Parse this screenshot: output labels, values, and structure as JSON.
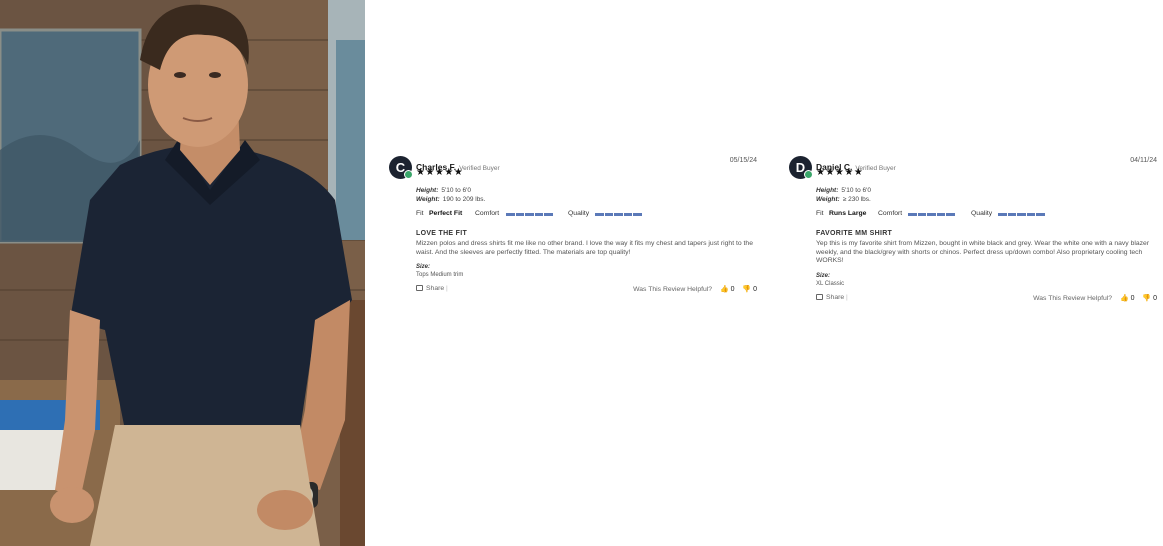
{
  "hero_image": {
    "alt": "Model wearing navy polo shirt and khaki pants"
  },
  "reviews": [
    {
      "avatar_letter": "C",
      "name": "Charles F.",
      "verified_label": "Verified Buyer",
      "stars": "★★★★★",
      "rating": 5,
      "date": "05/15/24",
      "height_label": "Height:",
      "height": "5'10 to 6'0",
      "weight_label": "Weight:",
      "weight": "190 to 209 lbs.",
      "fit_label": "Fit",
      "fit_value": "Perfect Fit",
      "comfort_label": "Comfort",
      "comfort_score": 5,
      "quality_label": "Quality",
      "quality_score": 5,
      "title": "LOVE THE FIT",
      "body": "Mizzen polos and dress shirts fit me like no other brand. I love the way it fits my chest and tapers just right to the waist. And the sleeves are perfectly fitted. The materials are top quality!",
      "size_label": "Size:",
      "size": "Tops Medium trim",
      "share_label": "Share",
      "helpful_label": "Was This Review Helpful?",
      "up_count": "0",
      "down_count": "0"
    },
    {
      "avatar_letter": "D",
      "name": "Daniel C.",
      "verified_label": "Verified Buyer",
      "stars": "★★★★★",
      "rating": 5,
      "date": "04/11/24",
      "height_label": "Height:",
      "height": "5'10 to 6'0",
      "weight_label": "Weight:",
      "weight": "≥ 230 lbs.",
      "fit_label": "Fit",
      "fit_value": "Runs Large",
      "comfort_label": "Comfort",
      "comfort_score": 5,
      "quality_label": "Quality",
      "quality_score": 5,
      "title": "FAVORITE MM SHIRT",
      "body": "Yep this is my favorite shirt from Mizzen, bought in white black and grey. Wear the white one with a navy blazer weekly, and the black/grey with shorts or chinos. Perfect dress up/down combo! Also proprietary cooling tech WORKS!",
      "size_label": "Size:",
      "size": "XL Classic",
      "share_label": "Share",
      "helpful_label": "Was This Review Helpful?",
      "up_count": "0",
      "down_count": "0"
    }
  ],
  "colors": {
    "avatar": "#1c2330",
    "verified_badge": "#3aa66a",
    "meter": "#5b79b8"
  }
}
